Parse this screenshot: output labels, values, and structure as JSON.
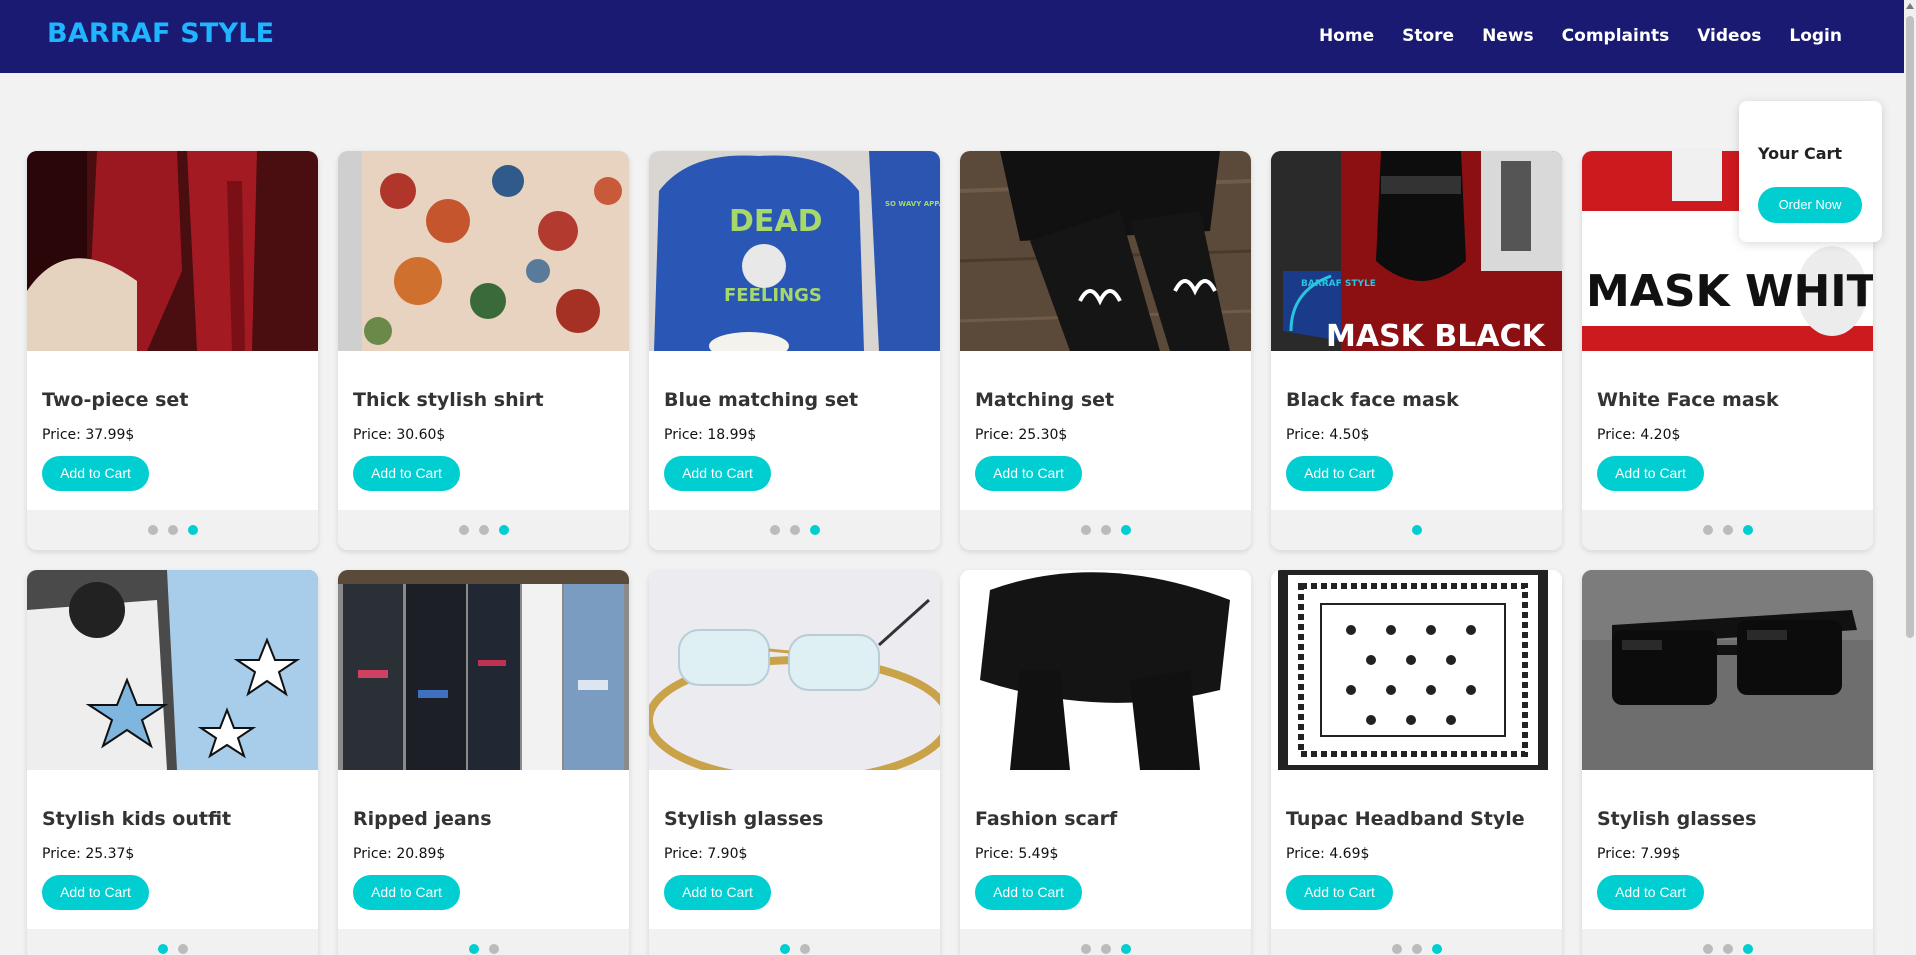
{
  "brand": "BARRAF STYLE",
  "nav": [
    "Home",
    "Store",
    "News",
    "Complaints",
    "Videos",
    "Login"
  ],
  "cart": {
    "title": "Your Cart",
    "order_label": "Order Now"
  },
  "add_label": "Add to Cart",
  "products": [
    {
      "name": "Two-piece set",
      "price": "Price: 37.99$",
      "dots": 3,
      "active": 2
    },
    {
      "name": "Thick stylish shirt",
      "price": "Price: 30.60$",
      "dots": 3,
      "active": 2
    },
    {
      "name": "Blue matching set",
      "price": "Price: 18.99$",
      "dots": 3,
      "active": 2,
      "image_text": [
        "DEAD",
        "FEELINGS",
        "SO WAVY APPAREL"
      ]
    },
    {
      "name": "Matching set",
      "price": "Price: 25.30$",
      "dots": 3,
      "active": 2
    },
    {
      "name": "Black face mask",
      "price": "Price: 4.50$",
      "dots": 1,
      "active": 0,
      "image_text": [
        "MASK BLACK",
        "BARRAF STYLE"
      ]
    },
    {
      "name": "White Face mask",
      "price": "Price: 4.20$",
      "dots": 3,
      "active": 2,
      "image_text": [
        "MASK WHITE"
      ]
    },
    {
      "name": "Stylish kids outfit",
      "price": "Price: 25.37$",
      "dots": 2,
      "active": 0
    },
    {
      "name": "Ripped jeans",
      "price": "Price: 20.89$",
      "dots": 2,
      "active": 0
    },
    {
      "name": "Stylish glasses",
      "price": "Price: 7.90$",
      "dots": 2,
      "active": 0
    },
    {
      "name": "Fashion scarf",
      "price": "Price: 5.49$",
      "dots": 3,
      "active": 2
    },
    {
      "name": "Tupac Headband Style",
      "price": "Price: 4.69$",
      "dots": 3,
      "active": 2
    },
    {
      "name": "Stylish glasses",
      "price": "Price: 7.99$",
      "dots": 3,
      "active": 2
    }
  ],
  "colors": {
    "navbar": "#1a1a73",
    "brand": "#1fb6ff",
    "accent": "#00ced1",
    "page_bg": "#f2f2f2"
  }
}
